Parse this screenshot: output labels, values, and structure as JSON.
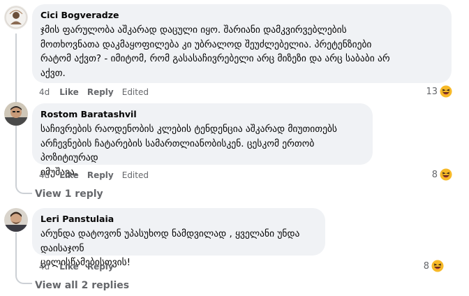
{
  "comments": [
    {
      "author": "Cici Bogveradze",
      "lines": [
        "ჯმის ფარულობა აშკარად დაცული იყო. შარიანი დამკვირვებლების",
        "მოთხოვნათა დაკმაყოფილება კი უბრალოდ შეუძლებელია. პრეტენზიები",
        "რატომ აქვთ? - იმიტომ, რომ გასასაჩივრებელი არც მიზეზი და არც საბაბი არ",
        "აქვთ."
      ],
      "time": "4d",
      "like": "Like",
      "reply": "Reply",
      "edited": "Edited",
      "reaction_count": "13",
      "reaction_icon": "laughing-emoji-icon"
    },
    {
      "author": "Rostom Baratashvil",
      "lines": [
        "საჩივრების რაოდენობის კლების ტენდენცია აშკარად მიუთითებს",
        "არჩევნების ჩატარების სამართლიანობისკენ. ცესკომ ერთობ პოზიტიურად",
        "იმუშავა."
      ],
      "time": "4d",
      "like": "Like",
      "reply": "Reply",
      "edited": "Edited",
      "reaction_count": "8",
      "reaction_icon": "laughing-emoji-icon"
    },
    {
      "author": "Leri Panstulaia",
      "lines": [
        "არუნდა დატოვონ უპასუხოდ ნამდვილად , ყველანი უნდა დაისაჯონ",
        "ცილისწამებისთვის!"
      ],
      "time": "4d",
      "like": "Like",
      "reply": "Reply",
      "reaction_count": "8",
      "reaction_icon": "laughing-emoji-icon"
    }
  ],
  "view_replies_1": "View 1 reply",
  "view_replies_2": "View all 2 replies",
  "colors": {
    "bubble": "#f0f2f5",
    "meta": "#65676b",
    "thread": "#ccd0d5",
    "emoji": "#f7b928"
  }
}
